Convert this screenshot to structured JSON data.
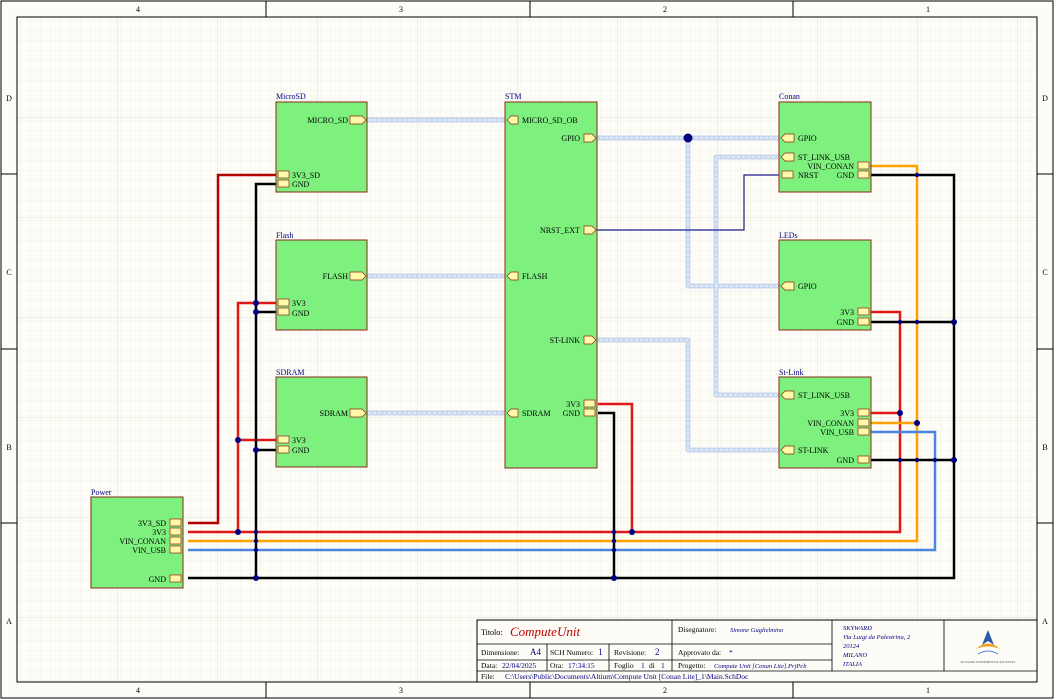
{
  "colors": {
    "block_fill": "#7ef07e",
    "block_stroke": "#8a2a1a",
    "port_fill": "#fff9a8",
    "wire_red": "#e01818",
    "wire_dark_red": "#b00000",
    "wire_orange": "#ffa200",
    "wire_blue": "#4a86e0",
    "wire_black": "#000000",
    "wire_navy": "#1c1c8c",
    "junction": "#000080",
    "bus": "#c8d8f0"
  },
  "border": {
    "top_columns": [
      "4",
      "3",
      "2",
      "1"
    ],
    "bottom_columns": [
      "4",
      "3",
      "2",
      "1"
    ],
    "rows": [
      "D",
      "C",
      "B",
      "A"
    ]
  },
  "blocks": {
    "microsd": {
      "title": "MicroSD",
      "ports": [
        "MICRO_SD",
        "3V3_SD",
        "GND"
      ]
    },
    "flash": {
      "title": "Flash",
      "ports": [
        "FLASH",
        "3V3",
        "GND"
      ]
    },
    "sdram": {
      "title": "SDRAM",
      "ports": [
        "SDRAM",
        "3V3",
        "GND"
      ]
    },
    "power": {
      "title": "Power",
      "ports": [
        "3V3_SD",
        "3V3",
        "VIN_CONAN",
        "VIN_USB",
        "GND"
      ]
    },
    "stm": {
      "title": "STM",
      "ports": [
        "MICRO_SD_OB",
        "GPIO",
        "NRST_EXT",
        "FLASH",
        "ST-LINK",
        "SDRAM",
        "3V3",
        "GND"
      ]
    },
    "conan": {
      "title": "Conan",
      "ports": [
        "GPIO",
        "ST_LINK_USB",
        "VIN_CONAN",
        "NRST",
        "GND"
      ]
    },
    "leds": {
      "title": "LEDs",
      "ports": [
        "GPIO",
        "3V3",
        "GND"
      ]
    },
    "stlink": {
      "title": "St-Link",
      "ports": [
        "ST_LINK_USB",
        "3V3",
        "VIN_CONAN",
        "VIN_USB",
        "ST-LINK",
        "GND"
      ]
    }
  },
  "title_block": {
    "title_label": "Titolo:",
    "title_value": "ComputeUnit",
    "designer_label": "Disegnatore:",
    "designer_value": "Simone Guglielmino",
    "size_label": "Dimensione:",
    "size_value": "A4",
    "sch_label": "SCH Numero:",
    "sch_value": "1",
    "rev_label": "Revisione:",
    "rev_value": "2",
    "approved_label": "Approvato da:",
    "approved_value": "*",
    "date_label": "Data:",
    "date_value": "22/04/2025",
    "time_label": "Ora:",
    "time_value": "17:34:15",
    "sheet_label": "Foglio",
    "sheet_num": "1",
    "sheet_of": "di",
    "sheet_total": "1",
    "project_label": "Progetto:",
    "project_value": "Compute Unit [Conan Lite].PrjPcb",
    "file_label": "File:",
    "file_value": "C:\\Users\\Public\\Documents\\Altium\\Compute Unit [Conan Lite]_1\\Main.SchDoc",
    "company": [
      "SKYWARD",
      "Via Luigi da Palestrina, 2",
      "20124",
      "MILANO",
      "ITALIA"
    ],
    "logo_caption": "SKYWARD EXPERIMENTAL ROCKETRY"
  }
}
